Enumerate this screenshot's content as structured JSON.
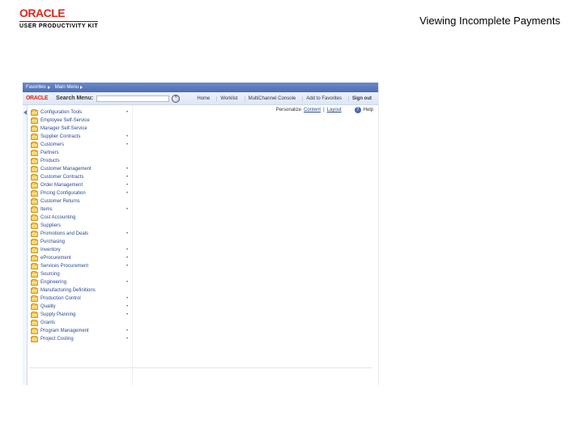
{
  "brand": {
    "name": "ORACLE",
    "product": "USER PRODUCTIVITY KIT"
  },
  "title": "Viewing Incomplete Payments",
  "app": {
    "bar": {
      "favorites": "Favorites",
      "main_menu": "Main Menu"
    },
    "inner_logo": "ORACLE",
    "search": {
      "label": "Search Menu:",
      "value": ""
    },
    "top_links": {
      "home": "Home",
      "worklist": "Worklist",
      "multichannel": "MultiChannel Console",
      "favorites": "Add to Favorites",
      "signout": "Sign out"
    },
    "personalize": {
      "prefix": "Personalize",
      "content": "Content",
      "layout": "Layout",
      "help": "Help"
    },
    "menu": [
      {
        "label": "Configuration Tools",
        "expand": true
      },
      {
        "label": "Employee Self-Service",
        "expand": false
      },
      {
        "label": "Manager Self-Service",
        "expand": false
      },
      {
        "label": "Supplier Contracts",
        "expand": true
      },
      {
        "label": "Customers",
        "expand": true
      },
      {
        "label": "Partners",
        "expand": false
      },
      {
        "label": "Products",
        "expand": false
      },
      {
        "label": "Customer Management",
        "expand": true
      },
      {
        "label": "Customer Contracts",
        "expand": true
      },
      {
        "label": "Order Management",
        "expand": true
      },
      {
        "label": "Pricing Configuration",
        "expand": true
      },
      {
        "label": "Customer Returns",
        "expand": false
      },
      {
        "label": "Items",
        "expand": true
      },
      {
        "label": "Cost Accounting",
        "expand": false
      },
      {
        "label": "Suppliers",
        "expand": false
      },
      {
        "label": "Promotions and Deals",
        "expand": true
      },
      {
        "label": "Purchasing",
        "expand": false
      },
      {
        "label": "Inventory",
        "expand": true
      },
      {
        "label": "eProcurement",
        "expand": true
      },
      {
        "label": "Services Procurement",
        "expand": true
      },
      {
        "label": "Sourcing",
        "expand": false
      },
      {
        "label": "Engineering",
        "expand": true
      },
      {
        "label": "Manufacturing Definitions",
        "expand": false
      },
      {
        "label": "Production Control",
        "expand": true
      },
      {
        "label": "Quality",
        "expand": true
      },
      {
        "label": "Supply Planning",
        "expand": true
      },
      {
        "label": "Grants",
        "expand": false
      },
      {
        "label": "Program Management",
        "expand": true
      },
      {
        "label": "Project Costing",
        "expand": true
      }
    ]
  }
}
